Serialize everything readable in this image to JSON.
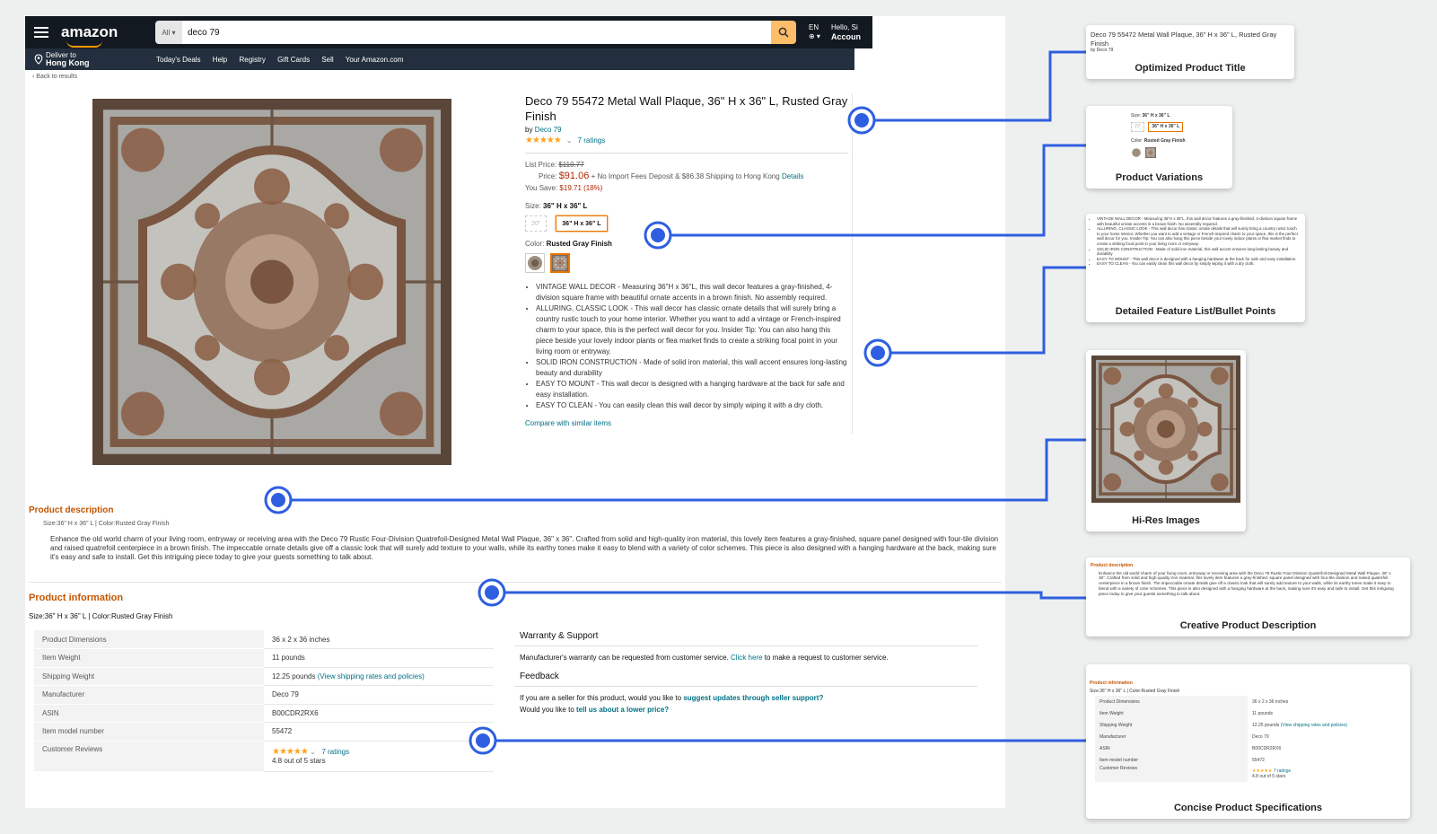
{
  "header": {
    "logo": "amazon",
    "search_category": "All",
    "search_query": "deco 79",
    "lang": "EN",
    "hello": "Hello, Si",
    "account": "Accoun"
  },
  "subnav": {
    "deliver_line1": "Deliver to",
    "deliver_line2": "Hong Kong",
    "links": [
      "Today's Deals",
      "Help",
      "Registry",
      "Gift Cards",
      "Sell",
      "Your Amazon.com"
    ]
  },
  "back": "‹ Back to results",
  "product": {
    "title": "Deco 79 55472 Metal Wall Plaque, 36\" H x 36\" L, Rusted Gray Finish",
    "by_prefix": "by",
    "brand": "Deco 79",
    "stars": "★★★★★",
    "ratings": "7 ratings",
    "list_price_label": "List Price:",
    "list_price": "$110.77",
    "price_label": "Price:",
    "price": "$91.06",
    "shipping": "+ No Import Fees Deposit & $86.38 Shipping to Hong Kong",
    "details_link": "Details",
    "save_label": "You Save:",
    "save": "$19.71 (18%)",
    "size_label": "Size:",
    "size_value": "36\" H x 36\" L",
    "size_options": [
      "20\"",
      "36\" H x 36\" L"
    ],
    "color_label": "Color:",
    "color_value": "Rusted Gray Finish",
    "bullets": [
      "VINTAGE WALL DECOR - Measuring 36\"H x 36\"L, this wall decor features a gray-finished, 4-division square frame with beautiful ornate accents in a brown finish. No assembly required.",
      "ALLURING, CLASSIC LOOK - This wall decor has classic ornate details that will surely bring a country rustic touch to your home interior. Whether you want to add a vintage or French-inspired charm to your space, this is the perfect wall decor for you. Insider Tip: You can also hang this piece beside your lovely indoor plants or flea market finds to create a striking focal point in your living room or entryway.",
      "SOLID IRON CONSTRUCTION - Made of solid iron material, this wall accent ensures long-lasting beauty and durability",
      "EASY TO MOUNT - This wall decor is designed with a hanging hardware at the back for safe and easy installation.",
      "EASY TO CLEAN - You can easily clean this wall decor by simply wiping it with a dry cloth."
    ],
    "compare": "Compare with similar items"
  },
  "description": {
    "title": "Product description",
    "sub": "Size:36\" H x 36\" L  |  Color:Rusted Gray Finish",
    "body": "Enhance the old world charm of your living room, entryway or receiving area with the Deco 79 Rustic Four-Division Quatrefoil-Designed Metal Wall Plaque, 36\" x 36\". Crafted from solid and high-quality iron material, this lovely item features a gray-finished, square panel designed with four-tile division and raised quatrefoil centerpiece in a brown finish. The impeccable ornate details give off a classic look that will surely add texture to your walls, while its earthy tones make it easy to blend with a variety of color schemes. This piece is also designed with a hanging hardware at the back, making sure it's easy and safe to install. Get this intriguing piece today to give your guests something to talk about."
  },
  "info": {
    "title": "Product information",
    "sub": "Size:36\" H x 36\" L  |  Color:Rusted Gray Finish",
    "rows": [
      {
        "k": "Product Dimensions",
        "v": "36 x 2 x 36 inches"
      },
      {
        "k": "Item Weight",
        "v": "11 pounds"
      },
      {
        "k": "Shipping Weight",
        "v": "12.25 pounds",
        "link": "(View shipping rates and policies)"
      },
      {
        "k": "Manufacturer",
        "v": "Deco 79"
      },
      {
        "k": "ASIN",
        "v": "B00CDR2RX6"
      },
      {
        "k": "Item model number",
        "v": "55472"
      },
      {
        "k": "Customer Reviews",
        "v": "4.8 out of 5 stars"
      }
    ]
  },
  "warranty": {
    "title": "Warranty & Support",
    "text1": "Manufacturer's warranty can be requested from customer service.",
    "link": "Click here",
    "text2": "to make a request to customer service."
  },
  "feedback": {
    "title": "Feedback",
    "text1": "If you are a seller for this product, would you like to",
    "link1": "suggest updates through seller support?",
    "text2": "Would you like to",
    "link2": "tell us about a lower price?"
  },
  "cards": [
    "Optimized Product Title",
    "Product Variations",
    "Detailed Feature List/Bullet Points",
    "Hi-Res Images",
    "Creative Product Description",
    "Concise Product Specifications"
  ],
  "colors": {
    "accent": "#2f5fe0",
    "orange": "#c45500",
    "price": "#b12704",
    "nav": "#131921"
  }
}
